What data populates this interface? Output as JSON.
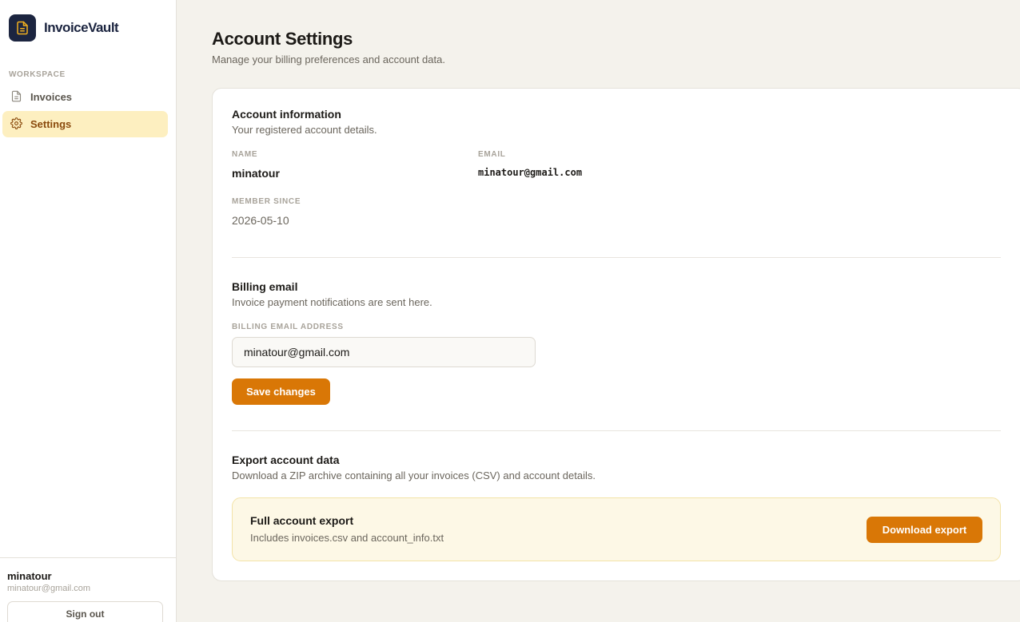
{
  "app": {
    "name": "InvoiceVault",
    "logo_icon": "document-icon",
    "accent": "#d97706",
    "brand_color": "#1c2540"
  },
  "sidebar": {
    "section_label": "WORKSPACE",
    "items": [
      {
        "label": "Invoices",
        "icon": "document-icon",
        "active": false
      },
      {
        "label": "Settings",
        "icon": "gear-icon",
        "active": true
      }
    ],
    "user": {
      "name": "minatour",
      "email": "minatour@gmail.com"
    },
    "signout_label": "Sign out"
  },
  "page": {
    "title": "Account Settings",
    "subtitle": "Manage your billing preferences and account data."
  },
  "account_info": {
    "title": "Account information",
    "description": "Your registered account details.",
    "name_label": "NAME",
    "name_value": "minatour",
    "email_label": "EMAIL",
    "email_value": "minatour@gmail.com",
    "member_since_label": "MEMBER SINCE",
    "member_since_value": "2026-05-10"
  },
  "billing": {
    "title": "Billing email",
    "description": "Invoice payment notifications are sent here.",
    "field_label": "BILLING EMAIL ADDRESS",
    "field_value": "minatour@gmail.com",
    "save_label": "Save changes"
  },
  "export": {
    "title": "Export account data",
    "description": "Download a ZIP archive containing all your invoices (CSV) and account details.",
    "box_title": "Full account export",
    "box_description": "Includes invoices.csv and account_info.txt",
    "download_label": "Download export"
  }
}
